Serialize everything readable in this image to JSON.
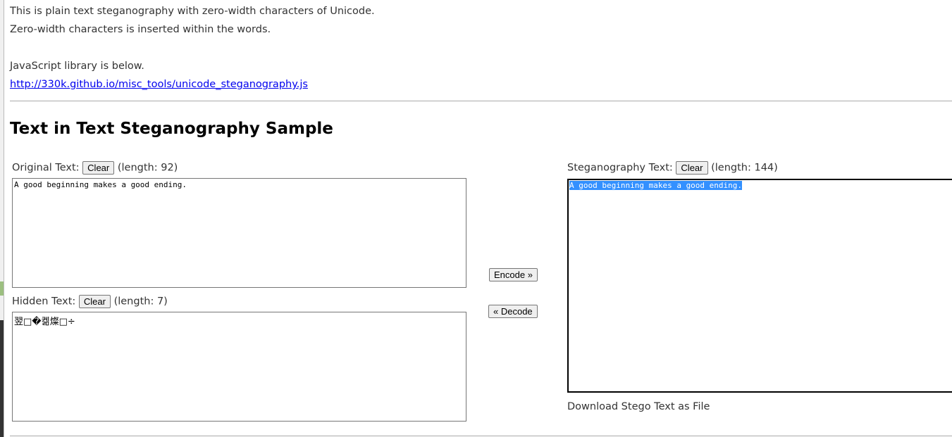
{
  "intro": {
    "line1": "This is plain text steganography with zero-width characters of Unicode.",
    "line2": "Zero-width characters is inserted within the words.",
    "line3": "JavaScript library is below.",
    "link": "http://330k.github.io/misc_tools/unicode_steganography.js"
  },
  "title": "Text in Text Steganography Sample",
  "original": {
    "label": "Original Text:",
    "clear": "Clear",
    "length": "(length: 92)",
    "value": "A good beginning makes a good ending."
  },
  "hidden": {
    "label": "Hidden Text:",
    "clear": "Clear",
    "length": "(length: 7)",
    "value": "翌□�켊燦□÷"
  },
  "stego": {
    "label": "Steganography Text:",
    "clear": "Clear",
    "length": "(length: 144)",
    "value": "A good beginning makes a good ending.",
    "download": "Download Stego Text as File"
  },
  "actions": {
    "encode": "Encode »",
    "decode": "« Decode"
  },
  "colors": {
    "selection": "#3390ff",
    "link": "#0000ee"
  }
}
